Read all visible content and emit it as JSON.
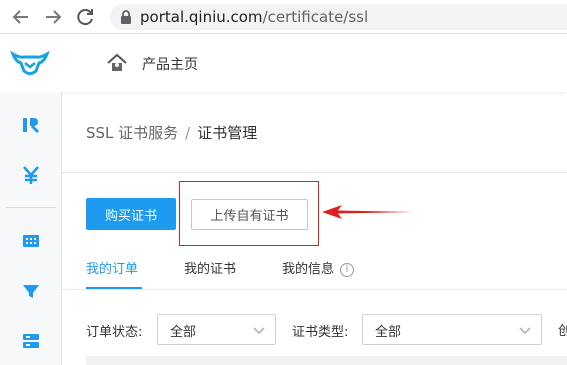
{
  "browser": {
    "url_host": "portal.qiniu.com",
    "url_path": "/certificate/ssl"
  },
  "header": {
    "home_label": "产品主页"
  },
  "breadcrumb": {
    "parent": "SSL 证书服务",
    "separator": "/",
    "current": "证书管理"
  },
  "actions": {
    "buy_label": "购买证书",
    "upload_label": "上传自有证书"
  },
  "tabs": [
    {
      "label": "我的订单",
      "active": true
    },
    {
      "label": "我的证书",
      "active": false
    },
    {
      "label": "我的信息",
      "active": false
    }
  ],
  "filters": {
    "order_status_label": "订单状态:",
    "order_status_value": "全部",
    "cert_type_label": "证书类型:",
    "cert_type_value": "全部",
    "truncated": "创"
  },
  "colors": {
    "primary": "#1e9bf0",
    "annotation_red": "#e02020"
  }
}
